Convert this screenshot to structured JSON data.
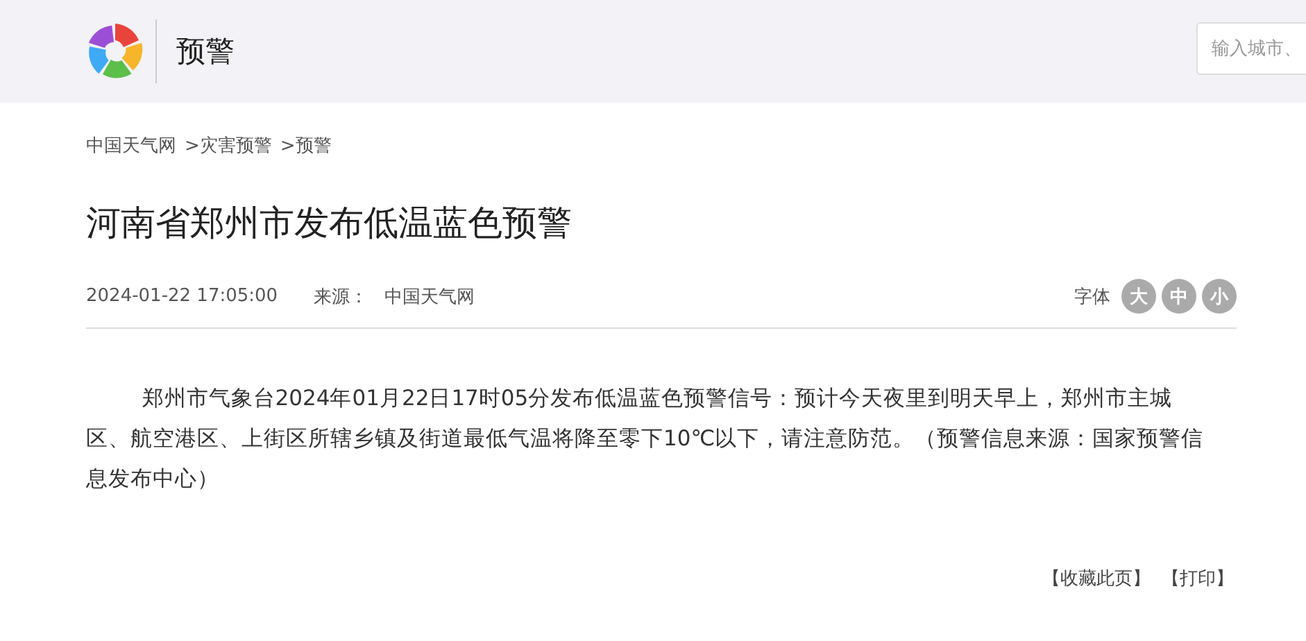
{
  "header": {
    "title": "预警",
    "search": {
      "placeholder": "输入城市、"
    }
  },
  "breadcrumb": [
    "中国天气网",
    ">灾害预警",
    ">预警"
  ],
  "article": {
    "title": "河南省郑州市发布低温蓝色预警",
    "time": "2024-01-22 17:05:00",
    "source_label": "来源：",
    "source": "中国天气网",
    "font_label": "字体",
    "font_sizes": [
      "大",
      "中",
      "小"
    ],
    "body": "郑州市气象台2024年01月22日17时05分发布低温蓝色预警信号：预计今天夜里到明天早上，郑州市主城区、航空港区、上街区所辖乡镇及街道最低气温将降至零下10℃以下，请注意防范。（预警信息来源：国家预警信息发布中心）"
  },
  "actions": [
    "【收藏此页】",
    "【打印】"
  ]
}
